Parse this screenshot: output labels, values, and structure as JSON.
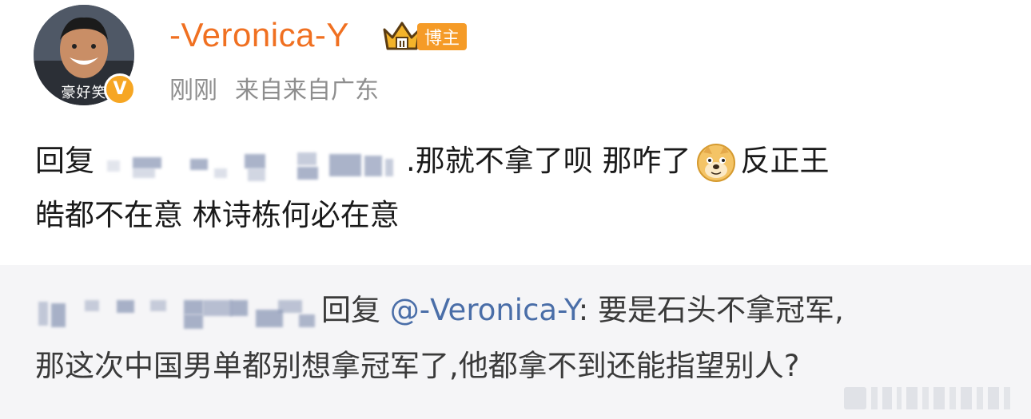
{
  "post": {
    "author": "-Veronica-Y",
    "avatar_caption": "豪好笑",
    "verified_badge": "V",
    "tag": "博主",
    "time": "刚刚",
    "source": "来自来自广东",
    "reply_prefix": "回复",
    "text_line1": ".那就不拿了呗 那咋了",
    "text_line1_end": "反正王",
    "text_line2": "皓都不在意 林诗栋何必在意",
    "emoji": "doge-icon"
  },
  "quote": {
    "reply_prefix": "回复",
    "mention": "@-Veronica-Y",
    "text_line1": ": 要是石头不拿冠军,",
    "text_line2": "那这次中国男单都别想拿冠军了,他都拿不到还能指望别人?"
  },
  "colors": {
    "username": "#f07021",
    "tag_bg": "#f59b27",
    "mention": "#4a6ea8",
    "meta": "#8e8e8e",
    "quote_bg": "#f5f5f7"
  }
}
